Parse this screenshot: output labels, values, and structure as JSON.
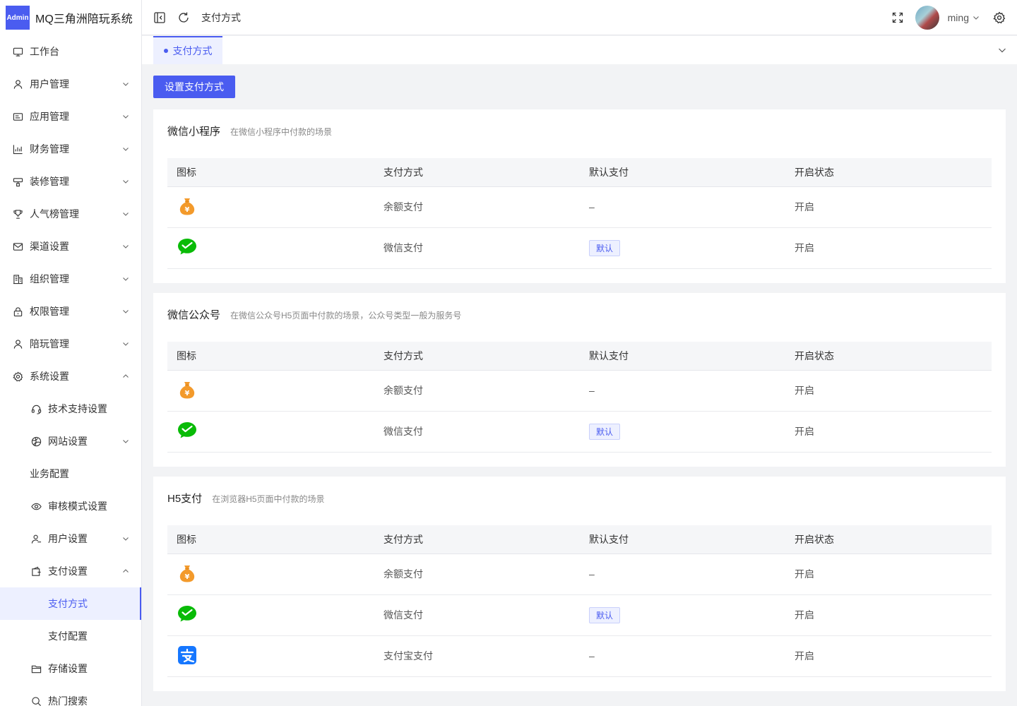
{
  "app": {
    "logo_badge": "Admin",
    "title": "MQ三角洲陪玩系统"
  },
  "sidebar": {
    "items": [
      {
        "label": "工作台",
        "icon": "monitor-icon"
      },
      {
        "label": "用户管理",
        "icon": "user-icon"
      },
      {
        "label": "应用管理",
        "icon": "app-card-icon"
      },
      {
        "label": "财务管理",
        "icon": "chart-icon"
      },
      {
        "label": "装修管理",
        "icon": "decoration-icon"
      },
      {
        "label": "人气榜管理",
        "icon": "trophy-icon"
      },
      {
        "label": "渠道设置",
        "icon": "mail-icon"
      },
      {
        "label": "组织管理",
        "icon": "building-icon"
      },
      {
        "label": "权限管理",
        "icon": "lock-icon"
      },
      {
        "label": "陪玩管理",
        "icon": "user-icon"
      },
      {
        "label": "系统设置",
        "icon": "gear-icon"
      },
      {
        "label": "技术支持设置",
        "icon": "headset-icon"
      },
      {
        "label": "网站设置",
        "icon": "globe-icon"
      },
      {
        "label": "业务配置"
      },
      {
        "label": "审核模式设置",
        "icon": "eye-icon"
      },
      {
        "label": "用户设置",
        "icon": "users-icon"
      },
      {
        "label": "支付设置",
        "icon": "wallet-icon"
      },
      {
        "label": "支付方式"
      },
      {
        "label": "支付配置"
      },
      {
        "label": "存储设置",
        "icon": "folder-icon"
      },
      {
        "label": "热门搜索",
        "icon": "search-icon"
      }
    ]
  },
  "header": {
    "breadcrumb": "支付方式",
    "username": "ming"
  },
  "tabs": {
    "active": "支付方式"
  },
  "toolbar": {
    "set_payment_label": "设置支付方式"
  },
  "table_headers": [
    "图标",
    "支付方式",
    "默认支付",
    "开启状态"
  ],
  "sections": [
    {
      "title": "微信小程序",
      "desc": "在微信小程序中付款的场景",
      "rows": [
        {
          "icon": "balance-icon",
          "method": "余额支付",
          "default": "–",
          "status": "开启"
        },
        {
          "icon": "wechat-pay-icon",
          "method": "微信支付",
          "default_tag": "默认",
          "status": "开启"
        }
      ]
    },
    {
      "title": "微信公众号",
      "desc": "在微信公众号H5页面中付款的场景，公众号类型一般为服务号",
      "rows": [
        {
          "icon": "balance-icon",
          "method": "余额支付",
          "default": "–",
          "status": "开启"
        },
        {
          "icon": "wechat-pay-icon",
          "method": "微信支付",
          "default_tag": "默认",
          "status": "开启"
        }
      ]
    },
    {
      "title": "H5支付",
      "desc": "在浏览器H5页面中付款的场景",
      "rows": [
        {
          "icon": "balance-icon",
          "method": "余额支付",
          "default": "–",
          "status": "开启"
        },
        {
          "icon": "wechat-pay-icon",
          "method": "微信支付",
          "default_tag": "默认",
          "status": "开启"
        },
        {
          "icon": "alipay-icon",
          "method": "支付宝支付",
          "default": "–",
          "status": "开启"
        }
      ]
    }
  ],
  "colors": {
    "primary": "#4a5cf0",
    "balance_orange": "#f39a2b",
    "wechat_green": "#09bb07",
    "alipay_blue": "#1677ff"
  }
}
